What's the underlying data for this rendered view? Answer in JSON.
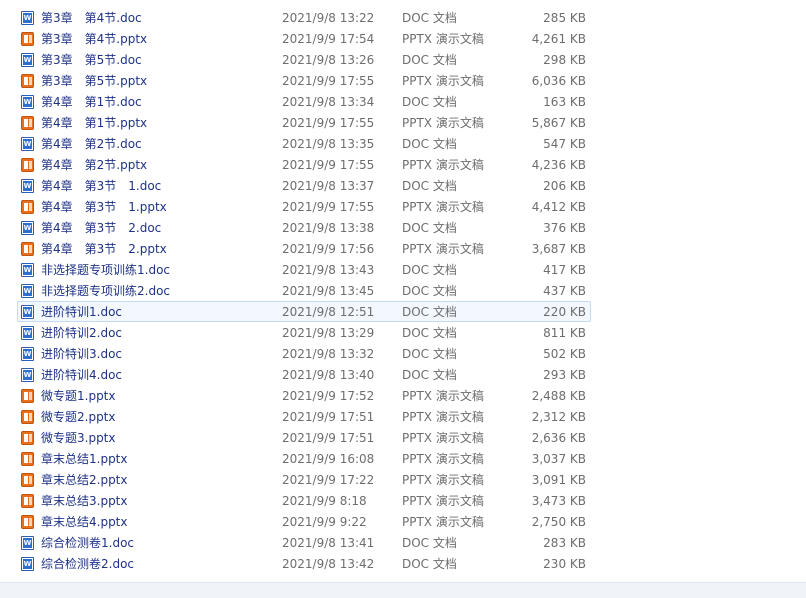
{
  "files": [
    {
      "name": "第3章　第4节.doc",
      "date": "2021/9/8 13:22",
      "type": "DOC 文档",
      "size": "285 KB",
      "icon": "doc"
    },
    {
      "name": "第3章　第4节.pptx",
      "date": "2021/9/9 17:54",
      "type": "PPTX 演示文稿",
      "size": "4,261 KB",
      "icon": "ppt"
    },
    {
      "name": "第3章　第5节.doc",
      "date": "2021/9/8 13:26",
      "type": "DOC 文档",
      "size": "298 KB",
      "icon": "doc"
    },
    {
      "name": "第3章　第5节.pptx",
      "date": "2021/9/9 17:55",
      "type": "PPTX 演示文稿",
      "size": "6,036 KB",
      "icon": "ppt"
    },
    {
      "name": "第4章　第1节.doc",
      "date": "2021/9/8 13:34",
      "type": "DOC 文档",
      "size": "163 KB",
      "icon": "doc"
    },
    {
      "name": "第4章　第1节.pptx",
      "date": "2021/9/9 17:55",
      "type": "PPTX 演示文稿",
      "size": "5,867 KB",
      "icon": "ppt"
    },
    {
      "name": "第4章　第2节.doc",
      "date": "2021/9/8 13:35",
      "type": "DOC 文档",
      "size": "547 KB",
      "icon": "doc"
    },
    {
      "name": "第4章　第2节.pptx",
      "date": "2021/9/9 17:55",
      "type": "PPTX 演示文稿",
      "size": "4,236 KB",
      "icon": "ppt"
    },
    {
      "name": "第4章　第3节　1.doc",
      "date": "2021/9/8 13:37",
      "type": "DOC 文档",
      "size": "206 KB",
      "icon": "doc"
    },
    {
      "name": "第4章　第3节　1.pptx",
      "date": "2021/9/9 17:55",
      "type": "PPTX 演示文稿",
      "size": "4,412 KB",
      "icon": "ppt"
    },
    {
      "name": "第4章　第3节　2.doc",
      "date": "2021/9/8 13:38",
      "type": "DOC 文档",
      "size": "376 KB",
      "icon": "doc"
    },
    {
      "name": "第4章　第3节　2.pptx",
      "date": "2021/9/9 17:56",
      "type": "PPTX 演示文稿",
      "size": "3,687 KB",
      "icon": "ppt"
    },
    {
      "name": "非选择题专项训练1.doc",
      "date": "2021/9/8 13:43",
      "type": "DOC 文档",
      "size": "417 KB",
      "icon": "doc"
    },
    {
      "name": "非选择题专项训练2.doc",
      "date": "2021/9/8 13:45",
      "type": "DOC 文档",
      "size": "437 KB",
      "icon": "doc"
    },
    {
      "name": "进阶特训1.doc",
      "date": "2021/9/8 12:51",
      "type": "DOC 文档",
      "size": "220 KB",
      "icon": "doc",
      "hover": true
    },
    {
      "name": "进阶特训2.doc",
      "date": "2021/9/8 13:29",
      "type": "DOC 文档",
      "size": "811 KB",
      "icon": "doc"
    },
    {
      "name": "进阶特训3.doc",
      "date": "2021/9/8 13:32",
      "type": "DOC 文档",
      "size": "502 KB",
      "icon": "doc"
    },
    {
      "name": "进阶特训4.doc",
      "date": "2021/9/8 13:40",
      "type": "DOC 文档",
      "size": "293 KB",
      "icon": "doc"
    },
    {
      "name": "微专题1.pptx",
      "date": "2021/9/9 17:52",
      "type": "PPTX 演示文稿",
      "size": "2,488 KB",
      "icon": "ppt"
    },
    {
      "name": "微专题2.pptx",
      "date": "2021/9/9 17:51",
      "type": "PPTX 演示文稿",
      "size": "2,312 KB",
      "icon": "ppt"
    },
    {
      "name": "微专题3.pptx",
      "date": "2021/9/9 17:51",
      "type": "PPTX 演示文稿",
      "size": "2,636 KB",
      "icon": "ppt"
    },
    {
      "name": "章末总结1.pptx",
      "date": "2021/9/9 16:08",
      "type": "PPTX 演示文稿",
      "size": "3,037 KB",
      "icon": "ppt"
    },
    {
      "name": "章末总结2.pptx",
      "date": "2021/9/9 17:22",
      "type": "PPTX 演示文稿",
      "size": "3,091 KB",
      "icon": "ppt"
    },
    {
      "name": "章末总结3.pptx",
      "date": "2021/9/9 8:18",
      "type": "PPTX 演示文稿",
      "size": "3,473 KB",
      "icon": "ppt"
    },
    {
      "name": "章末总结4.pptx",
      "date": "2021/9/9 9:22",
      "type": "PPTX 演示文稿",
      "size": "2,750 KB",
      "icon": "ppt"
    },
    {
      "name": "综合检测卷1.doc",
      "date": "2021/9/8 13:41",
      "type": "DOC 文档",
      "size": "283 KB",
      "icon": "doc"
    },
    {
      "name": "综合检测卷2.doc",
      "date": "2021/9/8 13:42",
      "type": "DOC 文档",
      "size": "230 KB",
      "icon": "doc"
    }
  ],
  "colors": {
    "name_text": "#1e3287",
    "detail_text": "#6d6d6d",
    "hover_bg": "#f2f8fe",
    "hover_border": "#c3dbf4",
    "doc_icon": "#2f6fd0",
    "ppt_icon": "#e8701a"
  }
}
